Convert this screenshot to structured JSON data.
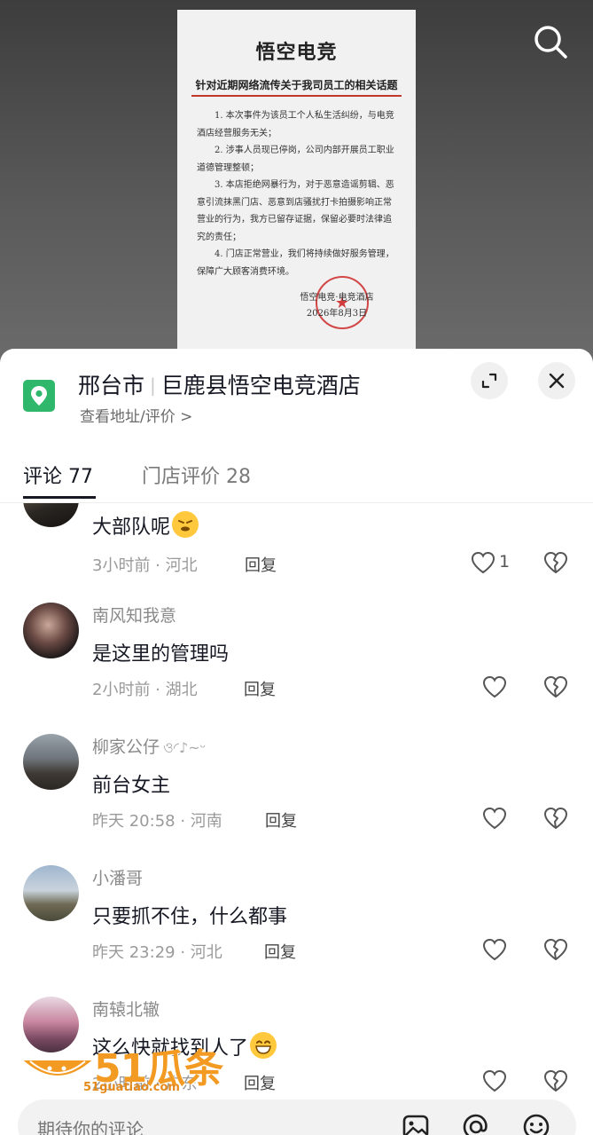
{
  "notice": {
    "logo": "悟空电竞",
    "heading": "针对近期网络流传关于我司员工的相关话题",
    "paragraphs": [
      "1. 本次事件为该员工个人私生活纠纷，与电竞酒店经营服务无关；",
      "2. 涉事人员现已停岗，公司内部开展员工职业道德管理整顿；",
      "3. 本店拒绝网暴行为，对于恶意造谣剪辑、恶意引流抹黑门店、恶意到店骚扰打卡拍摄影响正常营业的行为，我方已留存证据，保留必要时法律追究的责任；",
      "4. 门店正常营业，我们将持续做好服务管理，保障广大顾客消费环境。"
    ],
    "signature": "悟空电竞·电竞酒店",
    "date": "2026年8月3日"
  },
  "location": {
    "city": "邢台市",
    "name": "巨鹿县悟空电竞酒店",
    "subtitle": "查看地址/评价 >",
    "icon": "map-pin-icon",
    "icon_color": "#2fb86c"
  },
  "tabs": [
    {
      "label": "评论 77",
      "active": true
    },
    {
      "label": "门店评价 28",
      "active": false
    }
  ],
  "comments": [
    {
      "name": "",
      "text": "大部队呢",
      "emoji": "smirk-emoji",
      "meta": "3小时前 · 河北",
      "reply": "回复",
      "likes": "1"
    },
    {
      "name": "南风知我意",
      "text": "是这里的管理吗",
      "meta": "2小时前 · 湖北",
      "reply": "回复",
      "likes": ""
    },
    {
      "name": "柳家公仔",
      "name_suffix": "ও◜♪~ᵕ",
      "text": "前台女主",
      "meta": "昨天 20:58 · 河南",
      "reply": "回复",
      "likes": ""
    },
    {
      "name": "小潘哥",
      "text": "只要抓不住，什么都事",
      "meta": "昨天 23:29 · 河北",
      "reply": "回复",
      "likes": ""
    },
    {
      "name": "南辕北辙",
      "text": "这么快就找到人了",
      "emoji": "grin-emoji",
      "meta": "2小时前 · 广东",
      "reply": "回复",
      "likes": ""
    }
  ],
  "input": {
    "placeholder": "期待你的评论"
  },
  "watermark": {
    "brand": "51瓜条",
    "url": "51guatiao.com"
  },
  "colors": {
    "accent_green": "#2fb86c",
    "seal_red": "#cd2828",
    "watermark_orange": "#f29a22"
  }
}
